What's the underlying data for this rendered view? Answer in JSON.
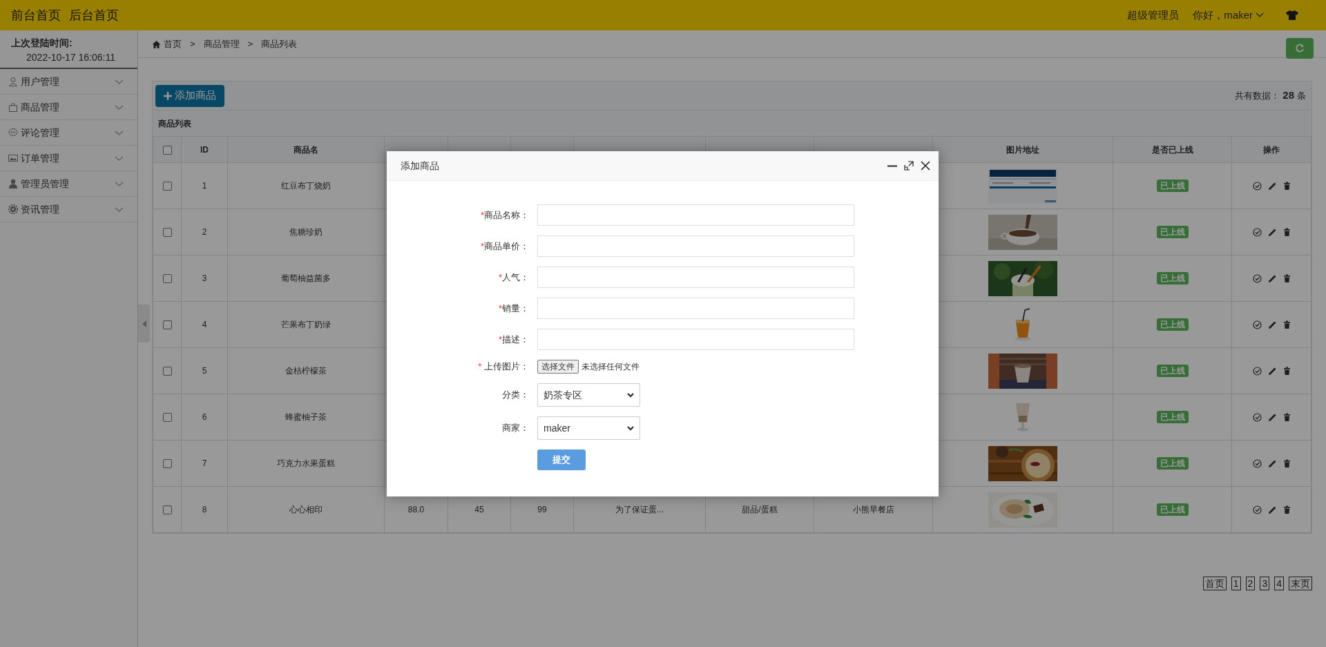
{
  "topbar": {
    "links": [
      "前台首页",
      "后台首页"
    ],
    "role": "超级管理员",
    "greeting": "你好，maker"
  },
  "sidebar": {
    "last_login_label": "上次登陆时间:",
    "last_login_time": "2022-10-17 16:06:11",
    "items": [
      {
        "label": "用户管理",
        "expanded": false
      },
      {
        "label": "商品管理",
        "expanded": false
      },
      {
        "label": "评论管理",
        "expanded": false
      },
      {
        "label": "订单管理",
        "expanded": false
      },
      {
        "label": "管理员管理",
        "expanded": false
      },
      {
        "label": "资讯管理",
        "expanded": false
      }
    ]
  },
  "breadcrumb": {
    "items": [
      "首页",
      "商品管理",
      "商品列表"
    ],
    "separator": ">"
  },
  "toolbar": {
    "add_button": "添加商品",
    "total_label": "共有数据：",
    "total_count": "28",
    "total_unit": "条"
  },
  "table": {
    "title": "商品列表",
    "all_checked": false,
    "columns": [
      "ID",
      "商品名",
      "图片地址",
      "是否已上线",
      "操作"
    ],
    "rows": [
      {
        "checked": false,
        "id": "1",
        "name": "红豆布丁烧奶",
        "status": "已上线"
      },
      {
        "checked": false,
        "id": "2",
        "name": "焦糖珍奶",
        "status": "已上线"
      },
      {
        "checked": false,
        "id": "3",
        "name": "葡萄柚益菌多",
        "status": "已上线"
      },
      {
        "checked": false,
        "id": "4",
        "name": "芒果布丁奶绿",
        "status": "已上线"
      },
      {
        "checked": false,
        "id": "5",
        "name": "金桔柠檬茶",
        "status": "已上线"
      },
      {
        "checked": false,
        "id": "6",
        "name": "蜂蜜柚子茶",
        "status": "已上线"
      },
      {
        "checked": false,
        "id": "7",
        "name": "巧克力水果蛋糕",
        "status": "已上线"
      },
      {
        "checked": false,
        "id": "8",
        "name": "心心相印",
        "price": "88.0",
        "popularity": "45",
        "sales": "99",
        "description": "为了保证蛋...",
        "category": "甜品/蛋糕",
        "shop": "小熊早餐店",
        "status": "已上线"
      }
    ]
  },
  "pagination": [
    "首页",
    "1",
    "2",
    "3",
    "4",
    "末页"
  ],
  "modal": {
    "title": "添加商品",
    "submit": "提交",
    "fields": [
      {
        "kind": "text",
        "mark": "*",
        "label": "商品名称："
      },
      {
        "kind": "text",
        "mark": "*",
        "label": "商品单价："
      },
      {
        "kind": "text",
        "mark": "*",
        "label": "人气："
      },
      {
        "kind": "text",
        "mark": "*",
        "label": "销量："
      },
      {
        "kind": "text",
        "mark": "*",
        "label": "描述："
      },
      {
        "kind": "file",
        "mark": "*",
        "label": " 上传图片：",
        "button": "选择文件",
        "status": "未选择任何文件"
      },
      {
        "kind": "select",
        "label": "分类：",
        "value": "奶茶专区"
      },
      {
        "kind": "select",
        "label": "商家：",
        "value": "maker"
      }
    ]
  }
}
